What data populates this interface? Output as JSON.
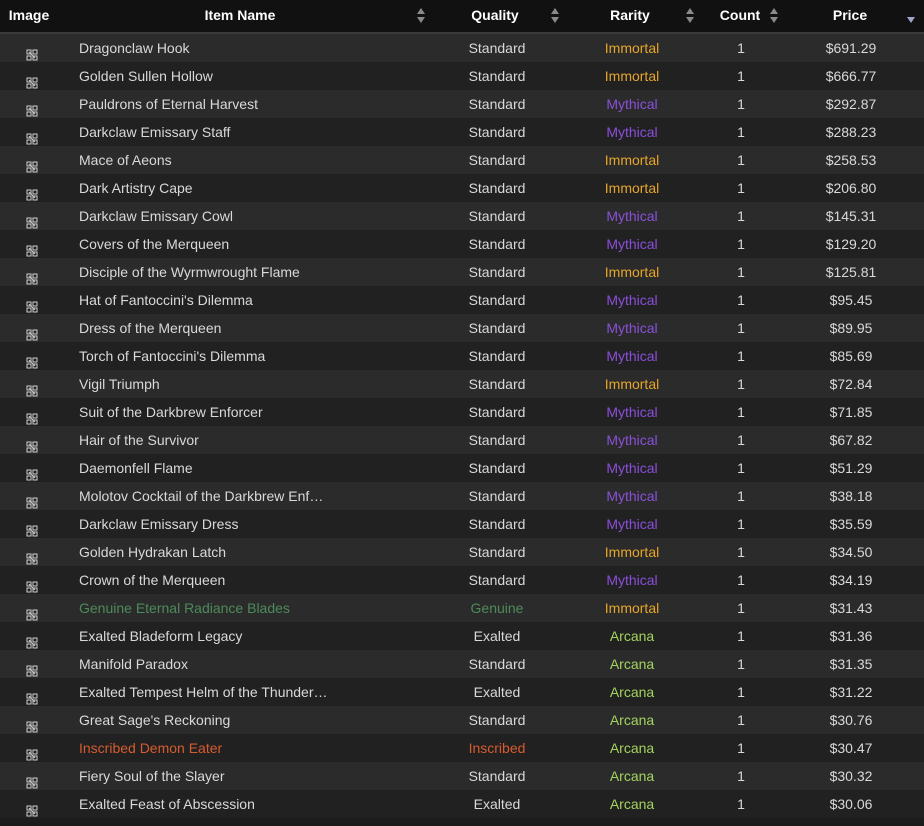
{
  "columns": {
    "image": "Image",
    "name": "Item Name",
    "quality": "Quality",
    "rarity": "Rarity",
    "count": "Count",
    "price": "Price"
  },
  "colors": {
    "Immortal": "#e6a52a",
    "Mythical": "#8a4fd9",
    "Arcana": "#a4d45c",
    "Genuine": "#4d8b5a",
    "Inscribed": "#d65c2e"
  },
  "icons": {
    "image_placeholder": "broken-image-icon",
    "sort": "sort-arrows-icon",
    "sort_desc": "sort-descending-icon"
  },
  "rows": [
    {
      "name": "Dragonclaw Hook",
      "quality": "Standard",
      "rarity": "Immortal",
      "count": "1",
      "price": "$691.29"
    },
    {
      "name": "Golden Sullen Hollow",
      "quality": "Standard",
      "rarity": "Immortal",
      "count": "1",
      "price": "$666.77"
    },
    {
      "name": "Pauldrons of Eternal Harvest",
      "quality": "Standard",
      "rarity": "Mythical",
      "count": "1",
      "price": "$292.87"
    },
    {
      "name": "Darkclaw Emissary Staff",
      "quality": "Standard",
      "rarity": "Mythical",
      "count": "1",
      "price": "$288.23"
    },
    {
      "name": "Mace of Aeons",
      "quality": "Standard",
      "rarity": "Immortal",
      "count": "1",
      "price": "$258.53"
    },
    {
      "name": "Dark Artistry Cape",
      "quality": "Standard",
      "rarity": "Immortal",
      "count": "1",
      "price": "$206.80"
    },
    {
      "name": "Darkclaw Emissary Cowl",
      "quality": "Standard",
      "rarity": "Mythical",
      "count": "1",
      "price": "$145.31"
    },
    {
      "name": "Covers of the Merqueen",
      "quality": "Standard",
      "rarity": "Mythical",
      "count": "1",
      "price": "$129.20"
    },
    {
      "name": "Disciple of the Wyrmwrought Flame",
      "quality": "Standard",
      "rarity": "Immortal",
      "count": "1",
      "price": "$125.81"
    },
    {
      "name": "Hat of Fantoccini's Dilemma",
      "quality": "Standard",
      "rarity": "Mythical",
      "count": "1",
      "price": "$95.45"
    },
    {
      "name": "Dress of the Merqueen",
      "quality": "Standard",
      "rarity": "Mythical",
      "count": "1",
      "price": "$89.95"
    },
    {
      "name": "Torch of Fantoccini's Dilemma",
      "quality": "Standard",
      "rarity": "Mythical",
      "count": "1",
      "price": "$85.69"
    },
    {
      "name": "Vigil Triumph",
      "quality": "Standard",
      "rarity": "Immortal",
      "count": "1",
      "price": "$72.84"
    },
    {
      "name": "Suit of the Darkbrew Enforcer",
      "quality": "Standard",
      "rarity": "Mythical",
      "count": "1",
      "price": "$71.85"
    },
    {
      "name": "Hair of the Survivor",
      "quality": "Standard",
      "rarity": "Mythical",
      "count": "1",
      "price": "$67.82"
    },
    {
      "name": "Daemonfell Flame",
      "quality": "Standard",
      "rarity": "Mythical",
      "count": "1",
      "price": "$51.29"
    },
    {
      "name": "Molotov Cocktail of the Darkbrew Enf…",
      "quality": "Standard",
      "rarity": "Mythical",
      "count": "1",
      "price": "$38.18"
    },
    {
      "name": "Darkclaw Emissary Dress",
      "quality": "Standard",
      "rarity": "Mythical",
      "count": "1",
      "price": "$35.59"
    },
    {
      "name": "Golden Hydrakan Latch",
      "quality": "Standard",
      "rarity": "Immortal",
      "count": "1",
      "price": "$34.50"
    },
    {
      "name": "Crown of the Merqueen",
      "quality": "Standard",
      "rarity": "Mythical",
      "count": "1",
      "price": "$34.19"
    },
    {
      "name": "Genuine Eternal Radiance Blades",
      "quality": "Genuine",
      "rarity": "Immortal",
      "count": "1",
      "price": "$31.43"
    },
    {
      "name": "Exalted Bladeform Legacy",
      "quality": "Exalted",
      "rarity": "Arcana",
      "count": "1",
      "price": "$31.36"
    },
    {
      "name": "Manifold Paradox",
      "quality": "Standard",
      "rarity": "Arcana",
      "count": "1",
      "price": "$31.35"
    },
    {
      "name": "Exalted Tempest Helm of the Thunder…",
      "quality": "Exalted",
      "rarity": "Arcana",
      "count": "1",
      "price": "$31.22"
    },
    {
      "name": "Great Sage's Reckoning",
      "quality": "Standard",
      "rarity": "Arcana",
      "count": "1",
      "price": "$30.76"
    },
    {
      "name": "Inscribed Demon Eater",
      "quality": "Inscribed",
      "rarity": "Arcana",
      "count": "1",
      "price": "$30.47"
    },
    {
      "name": "Fiery Soul of the Slayer",
      "quality": "Standard",
      "rarity": "Arcana",
      "count": "1",
      "price": "$30.32"
    },
    {
      "name": "Exalted Feast of Abscession",
      "quality": "Exalted",
      "rarity": "Arcana",
      "count": "1",
      "price": "$30.06"
    }
  ]
}
